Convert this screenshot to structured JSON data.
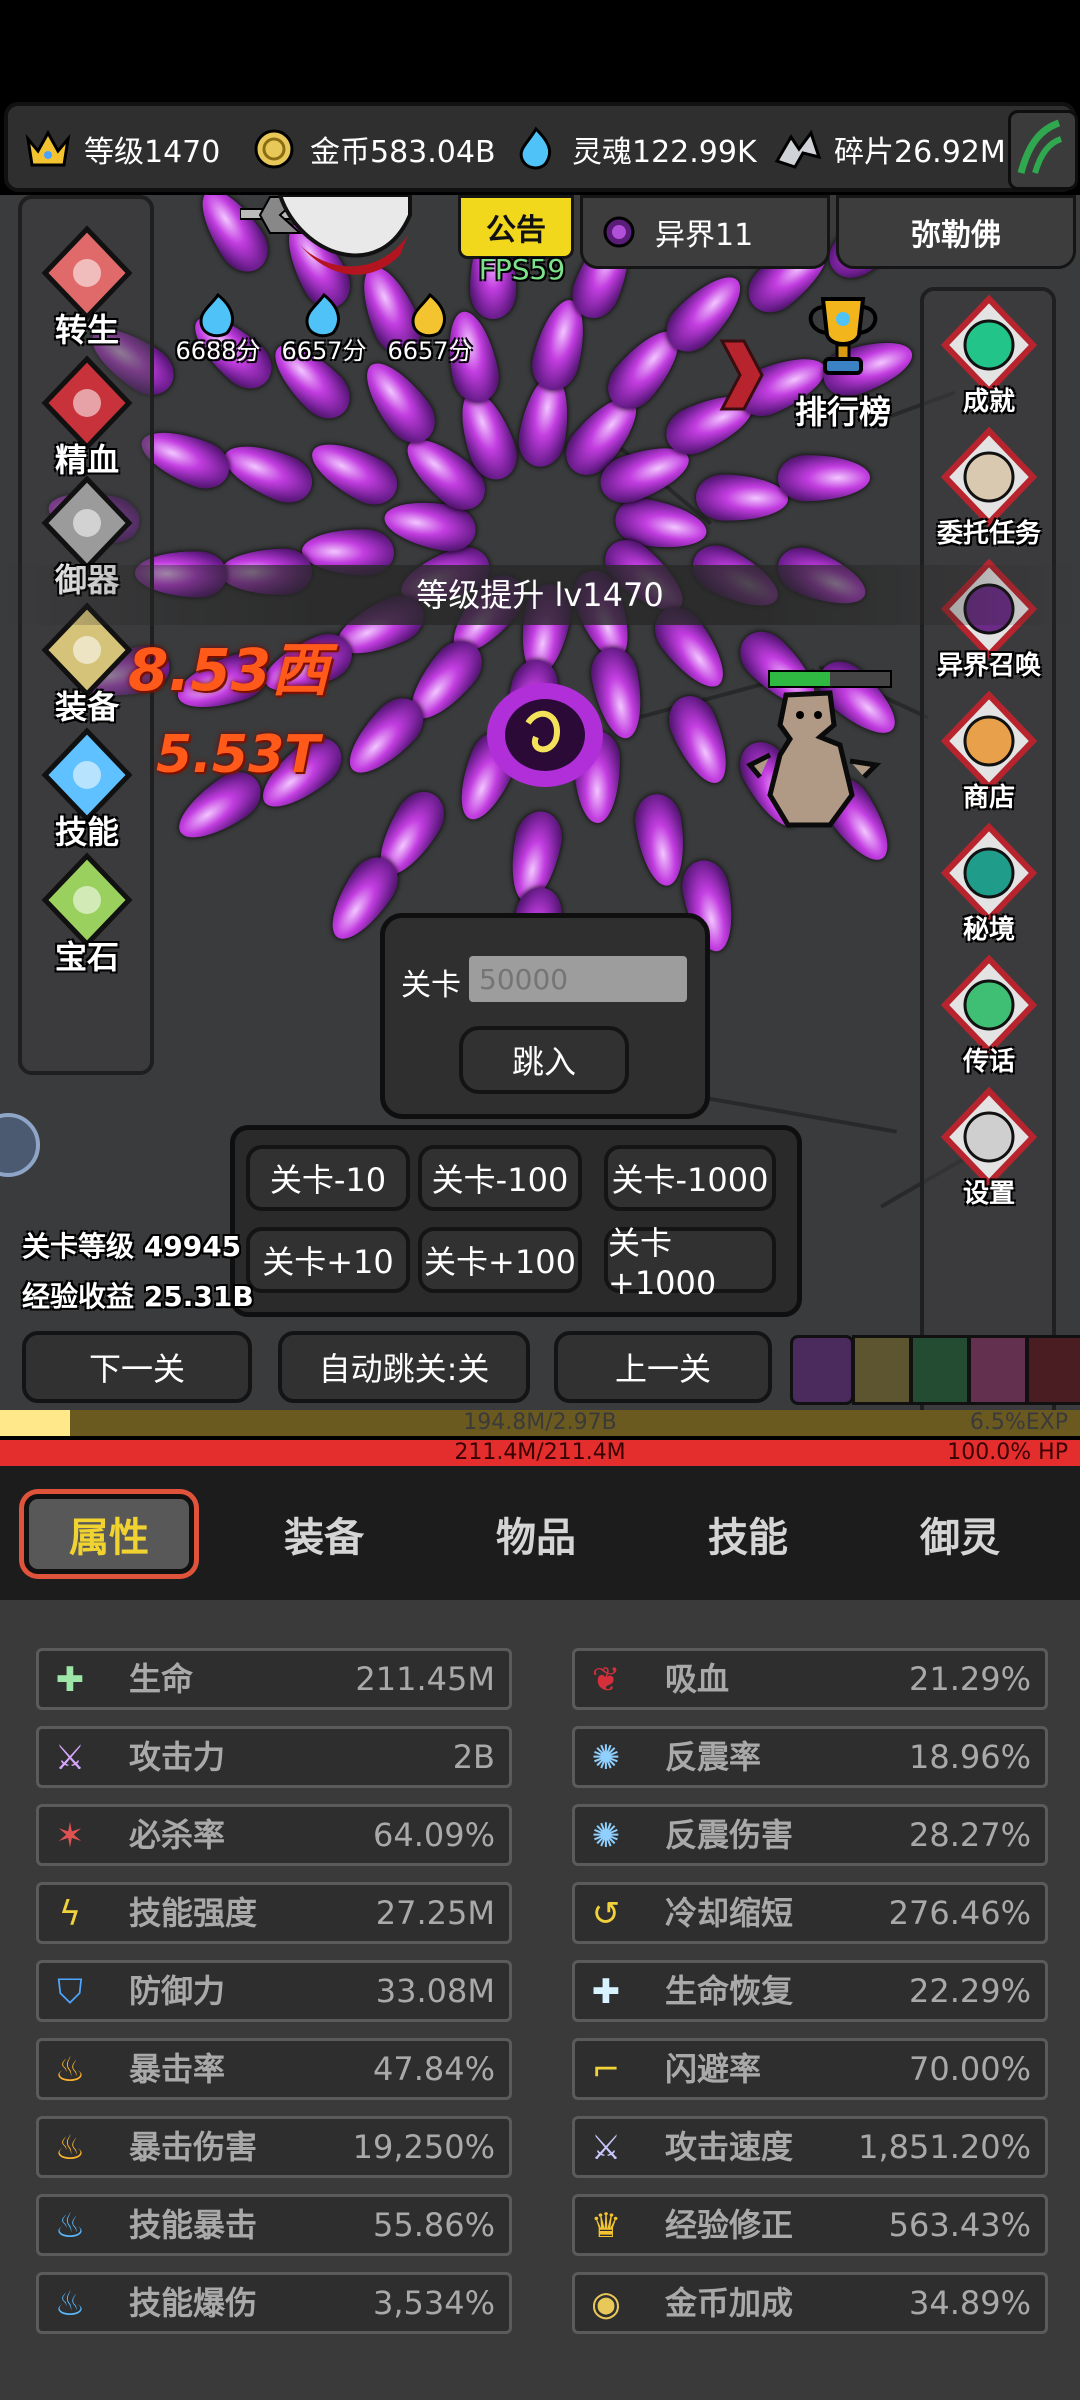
{
  "resources": [
    {
      "icon": "crown-icon",
      "label": "等级1470"
    },
    {
      "icon": "gold-coin-icon",
      "label": "金币583.04B"
    },
    {
      "icon": "soul-icon",
      "label": "灵魂122.99K"
    },
    {
      "icon": "shard-icon",
      "label": "碎片26.92M"
    }
  ],
  "header": {
    "notice": "公告",
    "otherworld": "异界11",
    "boss_name": "弥勒佛",
    "fps": "FPS59"
  },
  "score_badges": [
    "6688分",
    "6657分",
    "6657分"
  ],
  "left_menu": [
    "转生",
    "精血",
    "御器",
    "装备",
    "技能",
    "宝石"
  ],
  "ranking": "排行榜",
  "right_menu": [
    "成就",
    "委托任务",
    "异界召唤",
    "商店",
    "秘境",
    "传话",
    "设置"
  ],
  "level_up_msg": "等级提升 lv1470",
  "damage_numbers": [
    "8.53西",
    "5.53T"
  ],
  "stage_jump": {
    "label": "关卡",
    "placeholder": "50000",
    "jump_button": "跳入"
  },
  "stage_buttons": [
    "关卡-10",
    "关卡-100",
    "关卡-1000",
    "关卡+10",
    "关卡+100",
    "关卡+1000"
  ],
  "stage_info": {
    "stage_level": "关卡等级 49945",
    "exp_income": "经验收益 25.31B"
  },
  "nav_buttons": {
    "next": "下一关",
    "auto": "自动跳关:关",
    "prev": "上一关"
  },
  "exp_bar": {
    "text": "194.8M/2.97B",
    "percent_text": "6.5%EXP",
    "fill": 0.065
  },
  "hp_bar": {
    "text": "211.4M/211.4M",
    "percent_text": "100.0%   HP",
    "fill": 1.0
  },
  "tabs": [
    "属性",
    "装备",
    "物品",
    "技能",
    "御灵"
  ],
  "active_tab": 0,
  "stats_left": [
    {
      "icon": "life-cross-icon",
      "name": "生命",
      "value": "211.45M"
    },
    {
      "icon": "sword-icon",
      "name": "攻击力",
      "value": "2B"
    },
    {
      "icon": "critical-kill-icon",
      "name": "必杀率",
      "value": "64.09%"
    },
    {
      "icon": "lightning-icon",
      "name": "技能强度",
      "value": "27.25M"
    },
    {
      "icon": "shield-icon",
      "name": "防御力",
      "value": "33.08M"
    },
    {
      "icon": "fire-icon",
      "name": "暴击率",
      "value": "47.84%"
    },
    {
      "icon": "fire-icon",
      "name": "暴击伤害",
      "value": "19,250%"
    },
    {
      "icon": "blue-fire-icon",
      "name": "技能暴击",
      "value": "55.86%"
    },
    {
      "icon": "blue-fire-icon",
      "name": "技能爆伤",
      "value": "3,534%"
    }
  ],
  "stats_right": [
    {
      "icon": "bat-icon",
      "name": "吸血",
      "value": "21.29%"
    },
    {
      "icon": "thorn-icon",
      "name": "反震率",
      "value": "18.96%"
    },
    {
      "icon": "thorn-icon",
      "name": "反震伤害",
      "value": "28.27%"
    },
    {
      "icon": "cooldown-icon",
      "name": "冷却缩短",
      "value": "276.46%"
    },
    {
      "icon": "regen-icon",
      "name": "生命恢复",
      "value": "22.29%"
    },
    {
      "icon": "boot-icon",
      "name": "闪避率",
      "value": "70.00%"
    },
    {
      "icon": "swords-icon",
      "name": "攻击速度",
      "value": "1,851.20%"
    },
    {
      "icon": "crown-icon",
      "name": "经验修正",
      "value": "563.43%"
    },
    {
      "icon": "gold-coin-icon",
      "name": "金币加成",
      "value": "34.89%"
    }
  ]
}
